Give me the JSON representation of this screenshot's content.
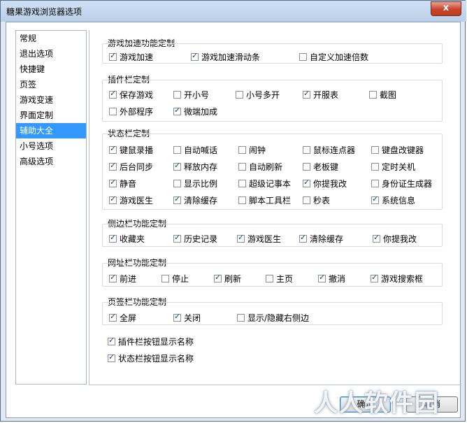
{
  "window": {
    "title": "糖果游戏浏览器选项",
    "close_glyph": "x"
  },
  "nav": {
    "items": [
      "常规",
      "退出选项",
      "快捷键",
      "页签",
      "游戏变速",
      "界面定制",
      "辅助大全",
      "小号选项",
      "高级选项"
    ],
    "selected": "辅助大全"
  },
  "sections": {
    "speed": {
      "title": "游戏加速功能定制",
      "items": [
        {
          "label": "游戏加速",
          "checked": true
        },
        {
          "label": "游戏加速滑动条",
          "checked": true
        },
        {
          "label": "自定义加速倍数",
          "checked": false
        }
      ]
    },
    "plugin": {
      "title": "插件栏定制",
      "items": [
        {
          "label": "保存游戏",
          "checked": true
        },
        {
          "label": "开小号",
          "checked": false
        },
        {
          "label": "小号多开",
          "checked": false
        },
        {
          "label": "开服表",
          "checked": true
        },
        {
          "label": "截图",
          "checked": false
        },
        {
          "label": "外部程序",
          "checked": false
        },
        {
          "label": "微端加成",
          "checked": true
        }
      ]
    },
    "status": {
      "title": "状态栏定制",
      "items": [
        {
          "label": "键鼠录播",
          "checked": true
        },
        {
          "label": "自动喊话",
          "checked": false
        },
        {
          "label": "闹钟",
          "checked": false
        },
        {
          "label": "鼠标连点器",
          "checked": false
        },
        {
          "label": "键盘改键器",
          "checked": false
        },
        {
          "label": "后台同步",
          "checked": true
        },
        {
          "label": "释放内存",
          "checked": true
        },
        {
          "label": "自动刷新",
          "checked": false
        },
        {
          "label": "老板键",
          "checked": false
        },
        {
          "label": "定时关机",
          "checked": false
        },
        {
          "label": "静音",
          "checked": true
        },
        {
          "label": "显示比例",
          "checked": false
        },
        {
          "label": "超级记事本",
          "checked": false
        },
        {
          "label": "你提我改",
          "checked": true
        },
        {
          "label": "身份证生成器",
          "checked": false
        },
        {
          "label": "游戏医生",
          "checked": true
        },
        {
          "label": "清除缓存",
          "checked": true
        },
        {
          "label": "脚本工具栏",
          "checked": false
        },
        {
          "label": "秒表",
          "checked": false
        },
        {
          "label": "系统信息",
          "checked": true
        }
      ]
    },
    "sidebar": {
      "title": "侧边栏功能定制",
      "items": [
        {
          "label": "收藏夹",
          "checked": true
        },
        {
          "label": "历史记录",
          "checked": true
        },
        {
          "label": "游戏医生",
          "checked": true
        },
        {
          "label": "清除缓存",
          "checked": true
        },
        {
          "label": "你提我改",
          "checked": true
        }
      ]
    },
    "urlbar": {
      "title": "网址栏功能定制",
      "items": [
        {
          "label": "前进",
          "checked": true
        },
        {
          "label": "停止",
          "checked": false
        },
        {
          "label": "刷新",
          "checked": true
        },
        {
          "label": "主页",
          "checked": false
        },
        {
          "label": "撤消",
          "checked": true
        },
        {
          "label": "游戏搜索框",
          "checked": true
        }
      ]
    },
    "tabbar": {
      "title": "页签栏功能定制",
      "items": [
        {
          "label": "全屏",
          "checked": true
        },
        {
          "label": "关闭",
          "checked": true
        },
        {
          "label": "显示/隐藏右侧边",
          "checked": false
        }
      ]
    },
    "extra": {
      "items": [
        {
          "label": "插件栏按钮显示名称",
          "checked": true
        },
        {
          "label": "状态栏按钮显示名称",
          "checked": true
        }
      ]
    }
  },
  "buttons": {
    "ok": "确定",
    "cancel": "取消"
  },
  "watermark": "人人软件园"
}
